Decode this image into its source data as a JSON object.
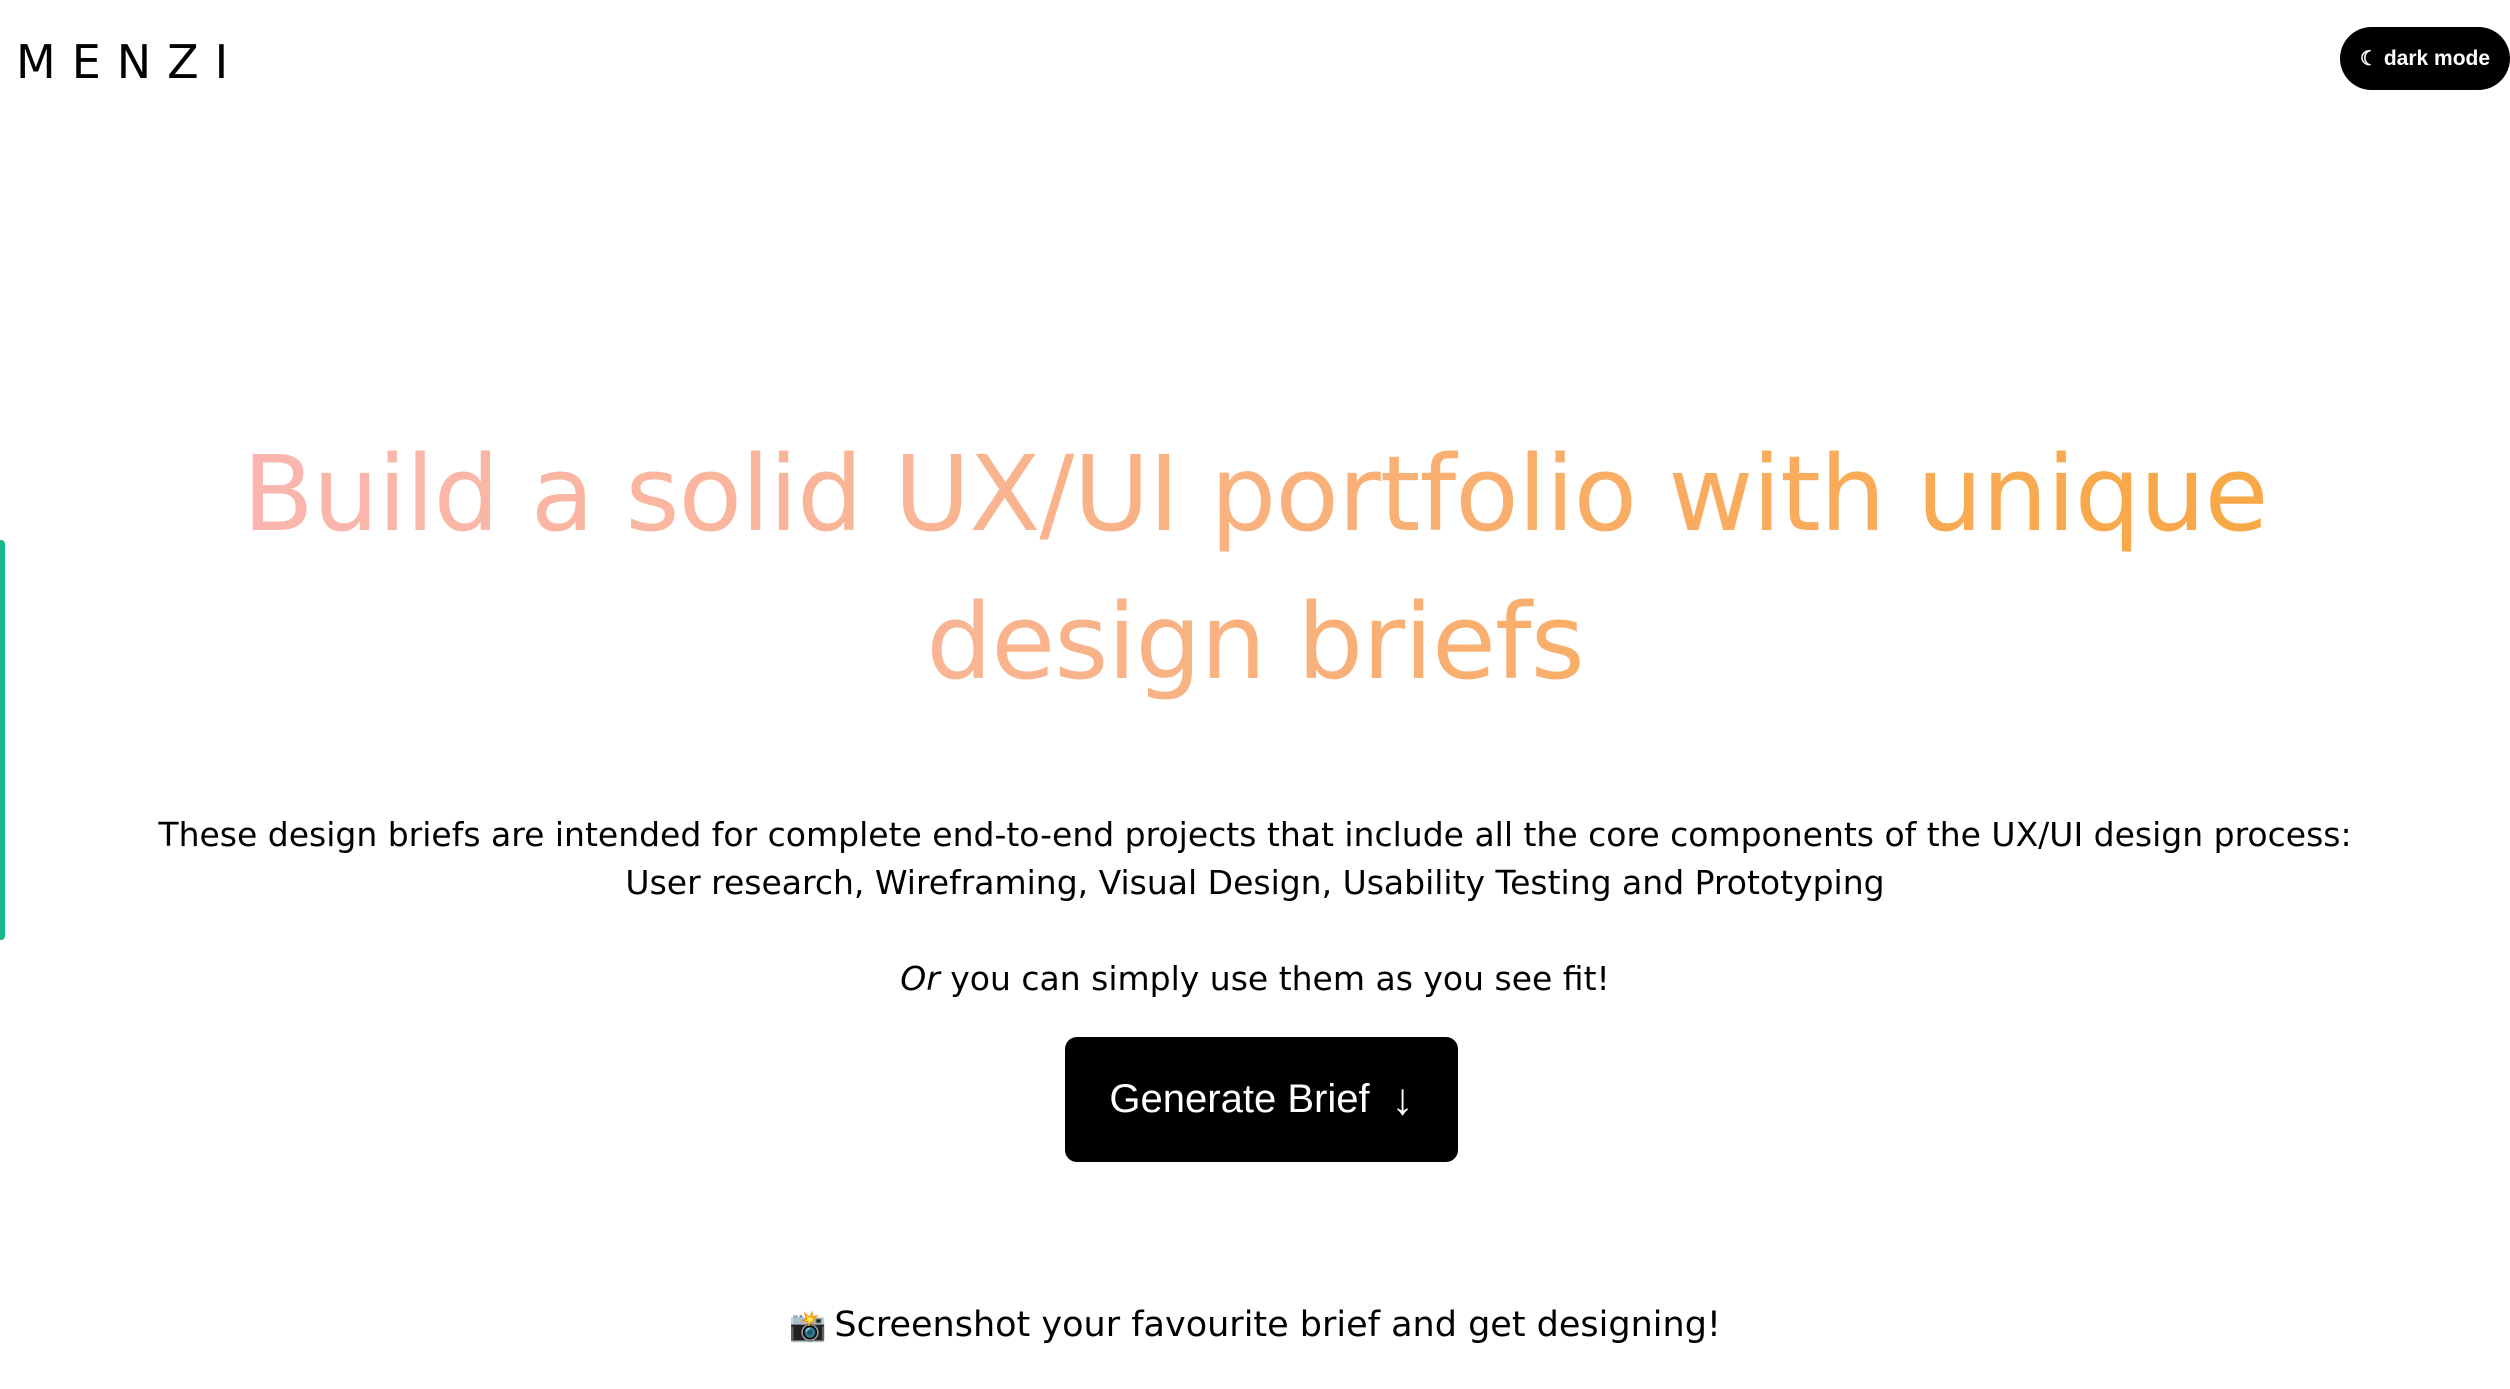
{
  "header": {
    "logo_text": "MENZI",
    "dark_mode_icon": "moon-icon",
    "dark_mode_glyph": "☾",
    "dark_mode_label": "dark mode"
  },
  "hero": {
    "title": "Build a solid UX/UI portfolio with unique design briefs",
    "description_line1": "These design briefs are intended for complete end-to-end projects that include all the core components of the UX/UI design process:",
    "description_line2": "User research, Wireframing, Visual Design, Usability Testing and Prototyping",
    "alt_emphasis": "Or",
    "alt_rest": " you can simply use them as you see fit!",
    "generate_label": "Generate Brief",
    "generate_icon": "arrow-down-icon",
    "generate_glyph": "↓",
    "tip_icon": "camera-icon",
    "tip_glyph": "📸",
    "tip_text": "Screenshot your favourite brief and get designing!"
  },
  "colors": {
    "title_gradient_start": "#fbb7b5",
    "title_gradient_end": "#f8a63c",
    "side_tab": "#17b78e",
    "button_bg": "#000000"
  }
}
